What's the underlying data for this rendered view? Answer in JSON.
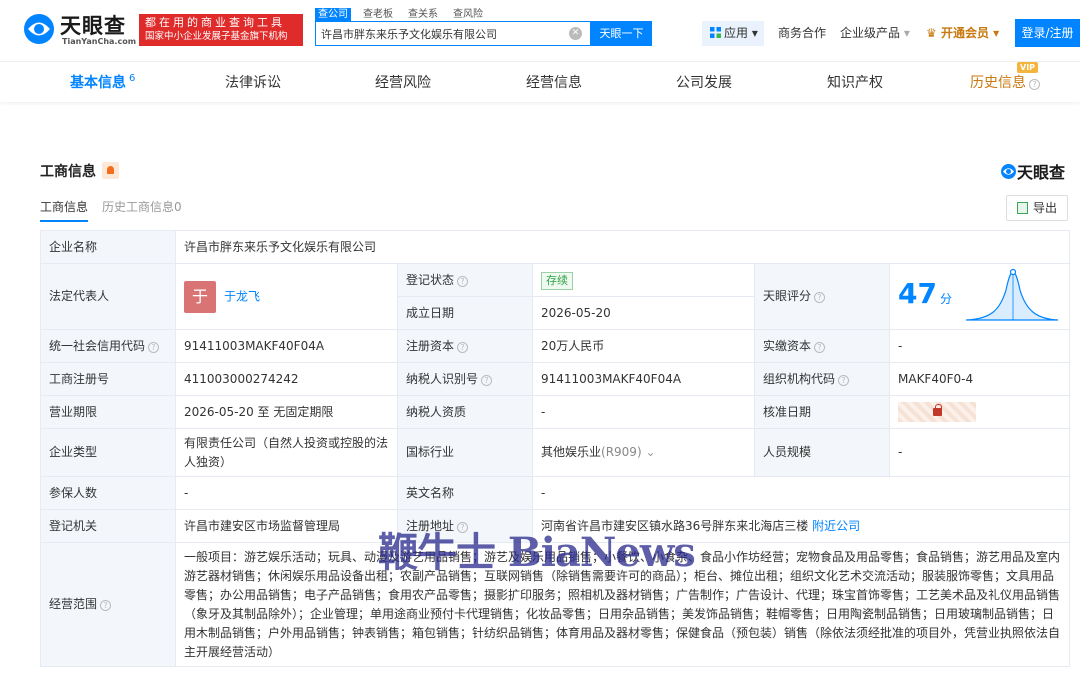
{
  "header": {
    "logo_name": "天眼查",
    "logo_pinyin": "TianYanCha.com",
    "slogan_line1": "都在用的商业查询工具",
    "slogan_line2": "国家中小企业发展子基金旗下机构",
    "search_tabs": [
      "查公司",
      "查老板",
      "查关系",
      "查风险"
    ],
    "search_value": "许昌市胖东来乐予文化娱乐有限公司",
    "search_button": "天眼一下",
    "app_button": "应用",
    "links": [
      "商务合作",
      "企业级产品",
      "开通会员"
    ],
    "login": "登录/注册"
  },
  "tabs": [
    {
      "label": "基本信息",
      "count": "6"
    },
    {
      "label": "法律诉讼"
    },
    {
      "label": "经营风险"
    },
    {
      "label": "经营信息"
    },
    {
      "label": "公司发展"
    },
    {
      "label": "知识产权"
    },
    {
      "label": "历史信息",
      "badge": "VIP"
    }
  ],
  "section": {
    "title": "工商信息",
    "brand": "天眼查",
    "subtabs": [
      "工商信息",
      "历史工商信息0"
    ],
    "export": "导出"
  },
  "info": {
    "company_name_label": "企业名称",
    "company_name": "许昌市胖东来乐予文化娱乐有限公司",
    "legal_rep_label": "法定代表人",
    "legal_rep_avatar": "于",
    "legal_rep": "于龙飞",
    "reg_status_label": "登记状态",
    "reg_status": "存续",
    "found_date_label": "成立日期",
    "found_date": "2026-05-20",
    "score_label": "天眼评分",
    "score": "47",
    "score_unit": "分",
    "credit_code_label": "统一社会信用代码",
    "credit_code": "91411003MAKF40F04A",
    "reg_capital_label": "注册资本",
    "reg_capital": "20万人民币",
    "paid_capital_label": "实缴资本",
    "paid_capital": "-",
    "reg_no_label": "工商注册号",
    "reg_no": "411003000274242",
    "taxpayer_id_label": "纳税人识别号",
    "taxpayer_id": "91411003MAKF40F04A",
    "org_code_label": "组织机构代码",
    "org_code": "MAKF40F0-4",
    "term_label": "营业期限",
    "term": "2026-05-20 至 无固定期限",
    "taxpayer_qual_label": "纳税人资质",
    "taxpayer_qual": "-",
    "approve_date_label": "核准日期",
    "type_label": "企业类型",
    "type": "有限责任公司（自然人投资或控股的法人独资）",
    "industry_label": "国标行业",
    "industry": "其他娱乐业",
    "industry_code": "(R909)",
    "staff_label": "人员规模",
    "staff": "-",
    "insured_label": "参保人数",
    "insured": "-",
    "english_label": "英文名称",
    "english": "-",
    "authority_label": "登记机关",
    "authority": "许昌市建安区市场监督管理局",
    "address_label": "注册地址",
    "address": "河南省许昌市建安区镇水路36号胖东来北海店三楼",
    "address_link": "附近公司",
    "scope_label": "经营范围",
    "scope": "一般项目：游艺娱乐活动；玩具、动漫及游艺用品销售；游艺及娱乐用品销售；小餐饮、小食杂、食品小作坊经营；宠物食品及用品零售；食品销售；游艺用品及室内游艺器材销售；休闲娱乐用品设备出租；农副产品销售；互联网销售（除销售需要许可的商品）；柜台、摊位出租；组织文化艺术交流活动；服装服饰零售；文具用品零售；办公用品销售；电子产品销售；食用农产品零售；摄影扩印服务；照相机及器材销售；广告制作；广告设计、代理；珠宝首饰零售；工艺美术品及礼仪用品销售（象牙及其制品除外）；企业管理；单用途商业预付卡代理销售；化妆品零售；日用杂品销售；美发饰品销售；鞋帽零售；日用陶瓷制品销售；日用玻璃制品销售；日用木制品销售；户外用品销售；钟表销售；箱包销售；针纺织品销售；体育用品及器材零售；保健食品（预包装）销售（除依法须经批准的项目外，凭营业执照依法自主开展经营活动）"
  },
  "watermark": "鞭牛士 BiaNews"
}
